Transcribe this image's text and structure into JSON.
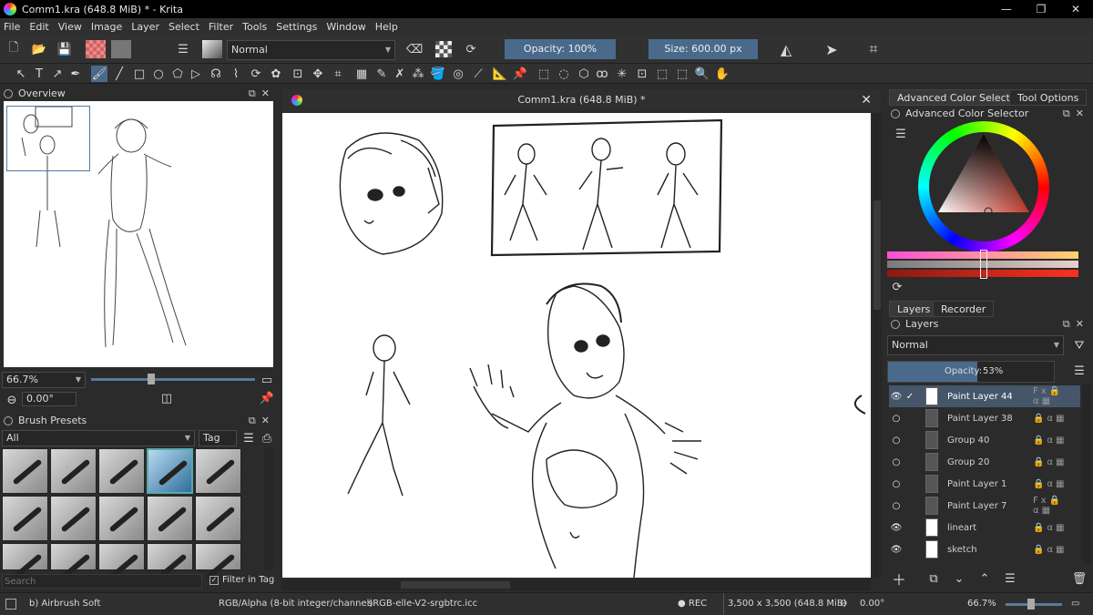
{
  "window": {
    "title": "Comm1.kra (648.8 MiB) * - Krita",
    "controls": [
      "—",
      "❐",
      "✕"
    ]
  },
  "menu": [
    "File",
    "Edit",
    "View",
    "Image",
    "Layer",
    "Select",
    "Filter",
    "Tools",
    "Settings",
    "Window",
    "Help"
  ],
  "toolbar": {
    "blend_mode": "Normal",
    "opacity_label": "Opacity: 100%",
    "size_label": "Size: 600.00 px"
  },
  "overview": {
    "title": "Overview",
    "zoom": "66.7%",
    "rotation": "0.00°"
  },
  "brush_presets": {
    "title": "Brush Presets",
    "filter": "All",
    "tag_label": "Tag",
    "search_placeholder": "Search",
    "filter_in_tag": "Filter in Tag"
  },
  "document": {
    "tab_title": "Comm1.kra (648.8 MiB) *"
  },
  "color_selector": {
    "tab1": "Advanced Color Selector",
    "tab2": "Tool Options",
    "panel_title": "Advanced Color Selector"
  },
  "layers": {
    "tab1": "Layers",
    "tab2": "Recorder",
    "panel_title": "Layers",
    "blend_mode": "Normal",
    "opacity_label": "Opacity:",
    "opacity_value": "53%",
    "items": [
      {
        "name": "Paint Layer 44",
        "visible": true,
        "active": true,
        "fx": true
      },
      {
        "name": "Paint Layer 38",
        "visible": false,
        "active": false,
        "fx": false
      },
      {
        "name": "Group 40",
        "visible": false,
        "active": false,
        "fx": false
      },
      {
        "name": "Group 20",
        "visible": false,
        "active": false,
        "fx": false
      },
      {
        "name": "Paint Layer 1",
        "visible": false,
        "active": false,
        "fx": false
      },
      {
        "name": "Paint Layer 7",
        "visible": false,
        "active": false,
        "fx": true
      },
      {
        "name": "lineart",
        "visible": true,
        "active": false,
        "fx": false
      },
      {
        "name": "sketch",
        "visible": true,
        "active": false,
        "fx": false
      }
    ]
  },
  "status": {
    "brush": "b) Airbrush Soft",
    "color_model": "RGB/Alpha (8-bit integer/channel)",
    "profile": "sRGB-elle-V2-srgbtrc.icc",
    "rec": "● REC",
    "dimensions": "3,500 x 3,500 (648.8 MiB)",
    "rotation": "0.00°",
    "zoom": "66.7%"
  },
  "colors": {
    "accent": "#4a6a8c",
    "active_layer": "#45566a",
    "background": "#2b2b2b"
  }
}
